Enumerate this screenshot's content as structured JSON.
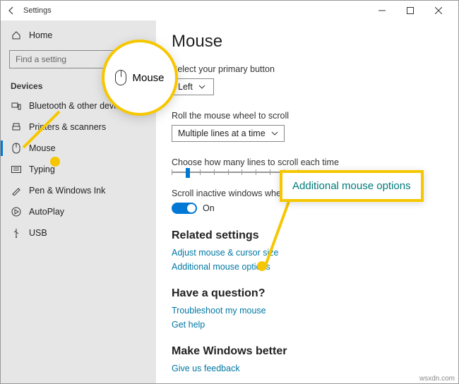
{
  "window": {
    "title": "Settings"
  },
  "sidebar": {
    "home": "Home",
    "search_placeholder": "Find a setting",
    "section": "Devices",
    "items": [
      {
        "label": "Bluetooth & other devices"
      },
      {
        "label": "Printers & scanners"
      },
      {
        "label": "Mouse"
      },
      {
        "label": "Typing"
      },
      {
        "label": "Pen & Windows Ink"
      },
      {
        "label": "AutoPlay"
      },
      {
        "label": "USB"
      }
    ]
  },
  "content": {
    "title": "Mouse",
    "primary_button_label": "Select your primary button",
    "primary_button_value": "Left",
    "wheel_label": "Roll the mouse wheel to scroll",
    "wheel_value": "Multiple lines at a time",
    "lines_label": "Choose how many lines to scroll each time",
    "inactive_label": "Scroll inactive windows when I hov",
    "toggle_state": "On",
    "related_heading": "Related settings",
    "related_link1": "Adjust mouse & cursor size",
    "related_link2": "Additional mouse options",
    "question_heading": "Have a question?",
    "question_link1": "Troubleshoot my mouse",
    "question_link2": "Get help",
    "better_heading": "Make Windows better",
    "better_link": "Give us feedback"
  },
  "callouts": {
    "circle_label": "Mouse",
    "box_label": "Additional mouse options"
  },
  "watermark": "wsxdn.com"
}
